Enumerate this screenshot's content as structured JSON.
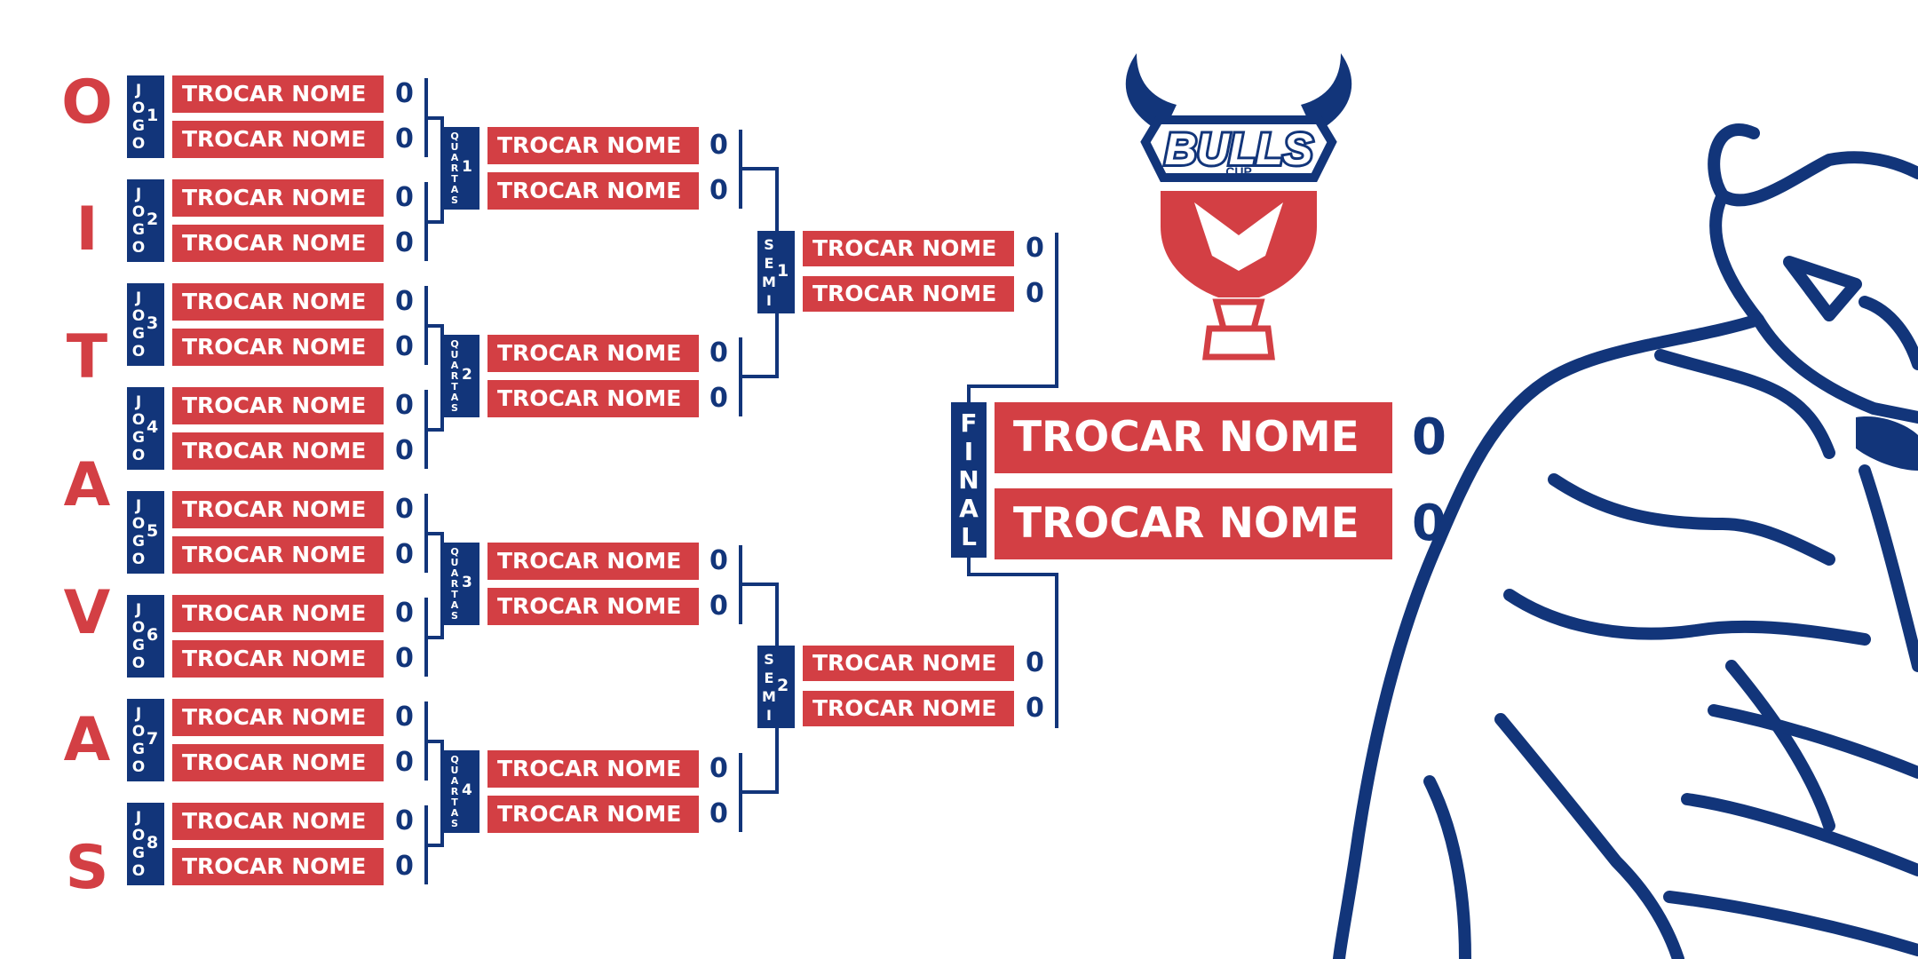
{
  "side_title": [
    "O",
    "I",
    "T",
    "A",
    "V",
    "A",
    "S"
  ],
  "labels": {
    "jogo": [
      "J",
      "O",
      "G",
      "O"
    ],
    "quartas": [
      "Q",
      "U",
      "A",
      "R",
      "T",
      "A",
      "S"
    ],
    "semi": [
      "S",
      "E",
      "M",
      "I"
    ],
    "final": [
      "F",
      "I",
      "N",
      "A",
      "L"
    ]
  },
  "logo": {
    "title": "BULLS",
    "subtitle": "CUP"
  },
  "colors": {
    "navy": "#12357a",
    "red": "#d33f44",
    "background": "#ffffff"
  },
  "rounds": {
    "oitavas": [
      {
        "number": "1",
        "teams": [
          "TROCAR NOME",
          "TROCAR NOME"
        ],
        "scores": [
          "0",
          "0"
        ]
      },
      {
        "number": "2",
        "teams": [
          "TROCAR NOME",
          "TROCAR NOME"
        ],
        "scores": [
          "0",
          "0"
        ]
      },
      {
        "number": "3",
        "teams": [
          "TROCAR NOME",
          "TROCAR NOME"
        ],
        "scores": [
          "0",
          "0"
        ]
      },
      {
        "number": "4",
        "teams": [
          "TROCAR NOME",
          "TROCAR NOME"
        ],
        "scores": [
          "0",
          "0"
        ]
      },
      {
        "number": "5",
        "teams": [
          "TROCAR NOME",
          "TROCAR NOME"
        ],
        "scores": [
          "0",
          "0"
        ]
      },
      {
        "number": "6",
        "teams": [
          "TROCAR NOME",
          "TROCAR NOME"
        ],
        "scores": [
          "0",
          "0"
        ]
      },
      {
        "number": "7",
        "teams": [
          "TROCAR NOME",
          "TROCAR NOME"
        ],
        "scores": [
          "0",
          "0"
        ]
      },
      {
        "number": "8",
        "teams": [
          "TROCAR NOME",
          "TROCAR NOME"
        ],
        "scores": [
          "0",
          "0"
        ]
      }
    ],
    "quartas": [
      {
        "number": "1",
        "teams": [
          "TROCAR NOME",
          "TROCAR NOME"
        ],
        "scores": [
          "0",
          "0"
        ]
      },
      {
        "number": "2",
        "teams": [
          "TROCAR NOME",
          "TROCAR NOME"
        ],
        "scores": [
          "0",
          "0"
        ]
      },
      {
        "number": "3",
        "teams": [
          "TROCAR NOME",
          "TROCAR NOME"
        ],
        "scores": [
          "0",
          "0"
        ]
      },
      {
        "number": "4",
        "teams": [
          "TROCAR NOME",
          "TROCAR NOME"
        ],
        "scores": [
          "0",
          "0"
        ]
      }
    ],
    "semi": [
      {
        "number": "1",
        "teams": [
          "TROCAR NOME",
          "TROCAR NOME"
        ],
        "scores": [
          "0",
          "0"
        ]
      },
      {
        "number": "2",
        "teams": [
          "TROCAR NOME",
          "TROCAR NOME"
        ],
        "scores": [
          "0",
          "0"
        ]
      }
    ],
    "final": {
      "teams": [
        "TROCAR NOME",
        "TROCAR NOME"
      ],
      "scores": [
        "0",
        "0"
      ]
    }
  }
}
